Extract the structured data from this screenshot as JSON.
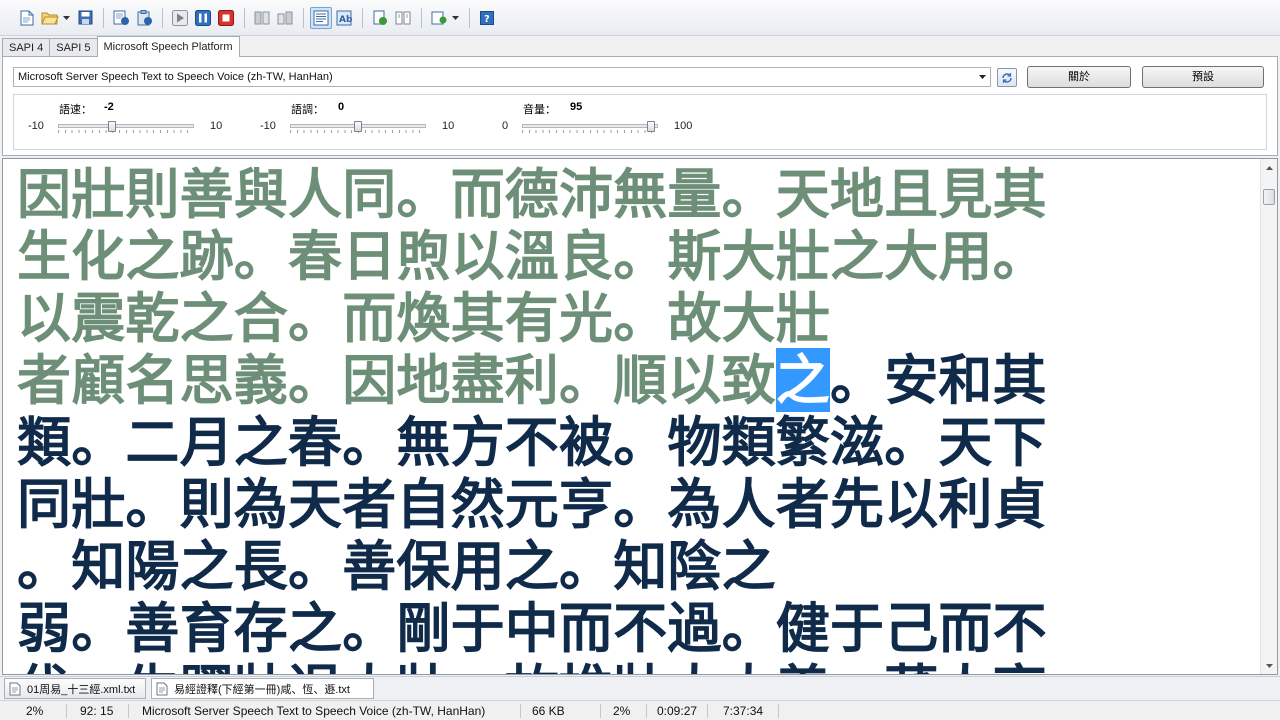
{
  "toolbar": {
    "buttons": [
      "new-file-icon",
      "open-folder-icon",
      "save-icon",
      "read-document-icon",
      "read-clipboard-icon",
      "play-icon",
      "pause-icon",
      "stop-icon",
      "skip-back-icon",
      "skip-forward-icon",
      "text-view-icon",
      "word-wrap-icon",
      "convert-audio-icon",
      "split-audio-icon",
      "voice-settings-icon",
      "help-icon"
    ]
  },
  "tabs": [
    {
      "label": "SAPI 4",
      "active": false
    },
    {
      "label": "SAPI 5",
      "active": false
    },
    {
      "label": "Microsoft Speech Platform",
      "active": true
    }
  ],
  "voice": {
    "selected": "Microsoft Server Speech Text to Speech Voice (zh-TW, HanHan)",
    "about_label": "關於",
    "default_label": "預設"
  },
  "sliders": [
    {
      "label": "語速：",
      "value": "-2",
      "min": "-10",
      "max": "10",
      "level": 0.4
    },
    {
      "label": "語調：",
      "value": "0",
      "min": "-10",
      "max": "10",
      "level": 0.5
    },
    {
      "label": "音量：",
      "value": "95",
      "min": "0",
      "max": "100",
      "level": 0.95
    }
  ],
  "text_lines": [
    {
      "spoken": "因壯則善與人同。而德沛無量。天地且見其",
      "current": "",
      "pending": ""
    },
    {
      "spoken": "生化之跡。春日煦以溫良。斯大壯之大用。",
      "current": "",
      "pending": ""
    },
    {
      "spoken": "以震乾之合。而煥其有光。故大壯",
      "current": "",
      "pending": ""
    },
    {
      "spoken": "者顧名思義。因地盡利。順以致",
      "current": "之",
      "pending": "。安和其"
    },
    {
      "spoken": "",
      "current": "",
      "pending": "類。二月之春。無方不被。物類繁滋。天下"
    },
    {
      "spoken": "",
      "current": "",
      "pending": "同壯。則為天者自然元亨。為人者先以利貞"
    },
    {
      "spoken": "",
      "current": "",
      "pending": "。知陽之長。善保用之。知陰之"
    },
    {
      "spoken": "",
      "current": "",
      "pending": "弱。善育存之。剛于中而不過。健于己而不"
    },
    {
      "spoken": "",
      "current": "",
      "pending": "伐。生躍壯逞大壯。故推壯大大義。蕃人亨"
    }
  ],
  "documents": [
    {
      "name": "01周易_十三經.xml.txt",
      "active": false
    },
    {
      "name": "易經證釋(下經第一冊)咸、恆、遯.txt",
      "active": true
    }
  ],
  "status": {
    "progress": "2%",
    "position": "92: 15",
    "voice": "Microsoft Server Speech Text to Speech Voice (zh-TW, HanHan)",
    "size": "66 KB",
    "percent": "2%",
    "elapsed": "0:09:27",
    "remaining": "7:37:34"
  },
  "colors": {
    "spoken_text": "#6d8f78",
    "pending_text": "#102a4a",
    "highlight": "#3399ff"
  }
}
